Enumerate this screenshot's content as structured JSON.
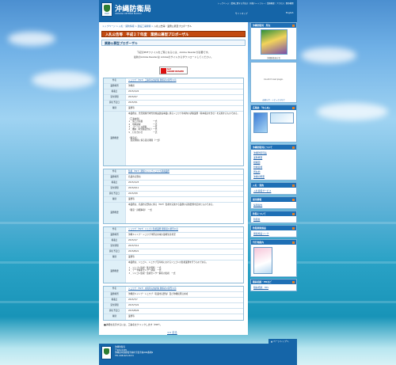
{
  "header": {
    "title": "沖縄防衛局",
    "subtitle": "OKINAWA DEFENSE BUREAU",
    "logo_caption": "防衛省",
    "top_links": "トップページ｜業務に関する手続き｜防衛ハートフルー｜業務概要｜アクセス｜関係機関",
    "sitemap": "サイトマップ",
    "english": "English"
  },
  "breadcrumb": {
    "items": [
      "トップページ",
      "入札・契約情報",
      "建設工事関係",
      "入札公告等・業務公募型プロポーザル"
    ]
  },
  "page_title": "入札公告等　平成２７年度　業務公募型プロポーザル",
  "section_title": "業務公募型プロポーザル",
  "pdf_note_1": "下記のPDFファイルをご覧になるには、Adobe Readerが必要です。",
  "pdf_note_2": "最新のAdobe Readerは Adobeのサイトからダウンロードしてください。",
  "adobe_badge": {
    "line1": "Get",
    "line2": "ADOBE READER"
  },
  "proposals": [
    {
      "name": "シュワブ（H27）工事等実施調査　関係者公募型公示",
      "rows": [
        {
          "label": "件名",
          "value": "シュワブ（H27）工事等実施調査 関係者公募型公示"
        },
        {
          "label": "業務場所",
          "value": "沖縄県"
        },
        {
          "label": "掲載日",
          "value": "2015/1/22"
        },
        {
          "label": "受付期限",
          "value": "2015/2/7"
        },
        {
          "label": "開札予定日",
          "value": "2015/3/1"
        },
        {
          "label": "種別",
          "value": "業務等"
        },
        {
          "label": "業務概要",
          "value": "本業務は、普天間飛行場代替施設建設事業に係るシュワブ水域内の調査業務（基本検討を含む）を実施するものである。\n\n（工事内容）\n１．施工計画書　　　　　一式\n２．現地調査　　　　　　一式\n３．コーハンス調査　　　一式\n４．機材（状況確認含む）一式\n５．打ち合わせ　　　　　一式\n\n（留意点）\n　受託期間に係る受託期間（一式）"
        }
      ]
    },
    {
      "name": "監視（H27）関係キャンプシュワブ調査業務",
      "rows": [
        {
          "label": "件名",
          "value": "監視（H27）関係キャンプシュワブ調査業務"
        },
        {
          "label": "業務場所",
          "value": "名護市辺野古"
        },
        {
          "label": "掲載日",
          "value": "2015/1/23"
        },
        {
          "label": "受付期限",
          "value": "2015/2/11"
        },
        {
          "label": "開札予定日",
          "value": "2015/3/8"
        },
        {
          "label": "種別",
          "value": "業務等"
        },
        {
          "label": "業務概要",
          "value": "本業務は、名護市辺野古に係る（H27）監視を実施する業務の実施要領を定めたものである。\n\n（留意・詳細事項）　一式"
        }
      ]
    },
    {
      "name": "シュワブ（H27）ジュゴン監視業務　関係者公募型公示",
      "rows": [
        {
          "label": "件名",
          "value": "シュワブ（H27）ジュゴン監視業務 関係者公募型公示"
        },
        {
          "label": "業務場所",
          "value": "沖縄キャンプ・シュワブ沖周辺水域の藻場生息状況"
        },
        {
          "label": "掲載日",
          "value": "2015/1/7"
        },
        {
          "label": "受付期限",
          "value": "2015/7/12"
        },
        {
          "label": "開札予定日",
          "value": "2015/8/21"
        },
        {
          "label": "種別",
          "value": "業務等"
        },
        {
          "label": "業務概要",
          "value": "本業務は、ジュゴン、シュワブ沿岸域におけるジュゴンの監視業務を行うものである。\n\n１．ジュゴン監視・集計資料　一式\n２．データ解析センサー調査　一式\n３．ジャゴン監視・監視センサー解析の監視　一式"
        }
      ]
    },
    {
      "name": "シュワブ（H27）水質等実施調査　関係者公募型公示",
      "rows": [
        {
          "label": "件名",
          "value": "シュワブ（H27）水質等実施調査 関係者公募型公示"
        },
        {
          "label": "業務場所",
          "value": "沖縄県キャンプ・シュワブ（名護市辺野古）及び沖縄県周辺水域"
        },
        {
          "label": "掲載日",
          "value": "2015/7/7"
        },
        {
          "label": "受付期限",
          "value": "2015/7/22"
        },
        {
          "label": "開札予定日",
          "value": "2015/8/26"
        },
        {
          "label": "種別",
          "value": "業務等"
        }
      ]
    }
  ],
  "footnote": "■詳細を表示するには、工事名をクリックします（PDF）。",
  "back_link": "<< 戻る",
  "page_top": "▲ ページトップへ",
  "sidebar": {
    "hd1": "沖縄防衛局　所在",
    "photo_caption": "沖縄防衛局庁舎",
    "plugin_text": "Couldn't load plugin.",
    "info_note": "お知らせ・トピックスなど",
    "hd2": "広報誌 「ゆんぬ」",
    "hd3": "沖縄防衛局について",
    "links3": [
      "沖縄防衛局長",
      "業務概要",
      "組織図",
      "管轄区域",
      "所在地",
      "沖縄の概要"
    ],
    "hd4": "入札・契約",
    "links4": [
      "入札情報サービス"
    ],
    "hd5": "採用情報",
    "links5": [
      "採用案内"
    ],
    "hd6": "防衛について",
    "links6": [
      "防衛省"
    ],
    "hd7": "防衛関連施設",
    "links7": [
      "関連施設リンク"
    ],
    "hd8": "刊行物案内",
    "hd9": "職員相談・PRなど",
    "links9": [
      "職員相談：MIS"
    ]
  },
  "footer": {
    "name": "沖縄防衛局",
    "text": "沖縄防衛局\n〒904-0295\n沖縄県中頭郡嘉手納町字嘉手納290番地9\nTEL 098-921-8131"
  }
}
